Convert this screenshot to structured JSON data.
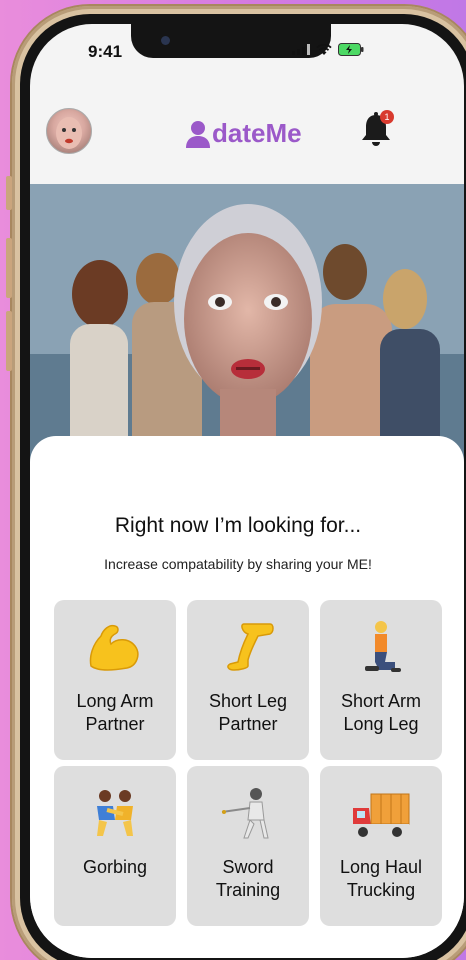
{
  "status_bar": {
    "time": "9:41"
  },
  "header": {
    "brand": "dateMe",
    "notification_count": "1"
  },
  "sheet": {
    "title": "Right now I’m looking for...",
    "subtitle": "Increase compatability by sharing your ME!"
  },
  "options": [
    {
      "label": "Long Arm\nPartner",
      "icon": "flexed-biceps-icon"
    },
    {
      "label": "Short Leg\nPartner",
      "icon": "leg-icon"
    },
    {
      "label": "Short Arm\nLong Leg",
      "icon": "kneeling-person-icon"
    },
    {
      "label": "Gorbing",
      "icon": "wrestlers-icon"
    },
    {
      "label": "Sword\nTraining",
      "icon": "fencer-icon"
    },
    {
      "label": "Long Haul\nTrucking",
      "icon": "delivery-truck-icon"
    }
  ],
  "colors": {
    "brand": "#9b59c9",
    "card": "#dedede",
    "badge": "#d83a2e"
  }
}
